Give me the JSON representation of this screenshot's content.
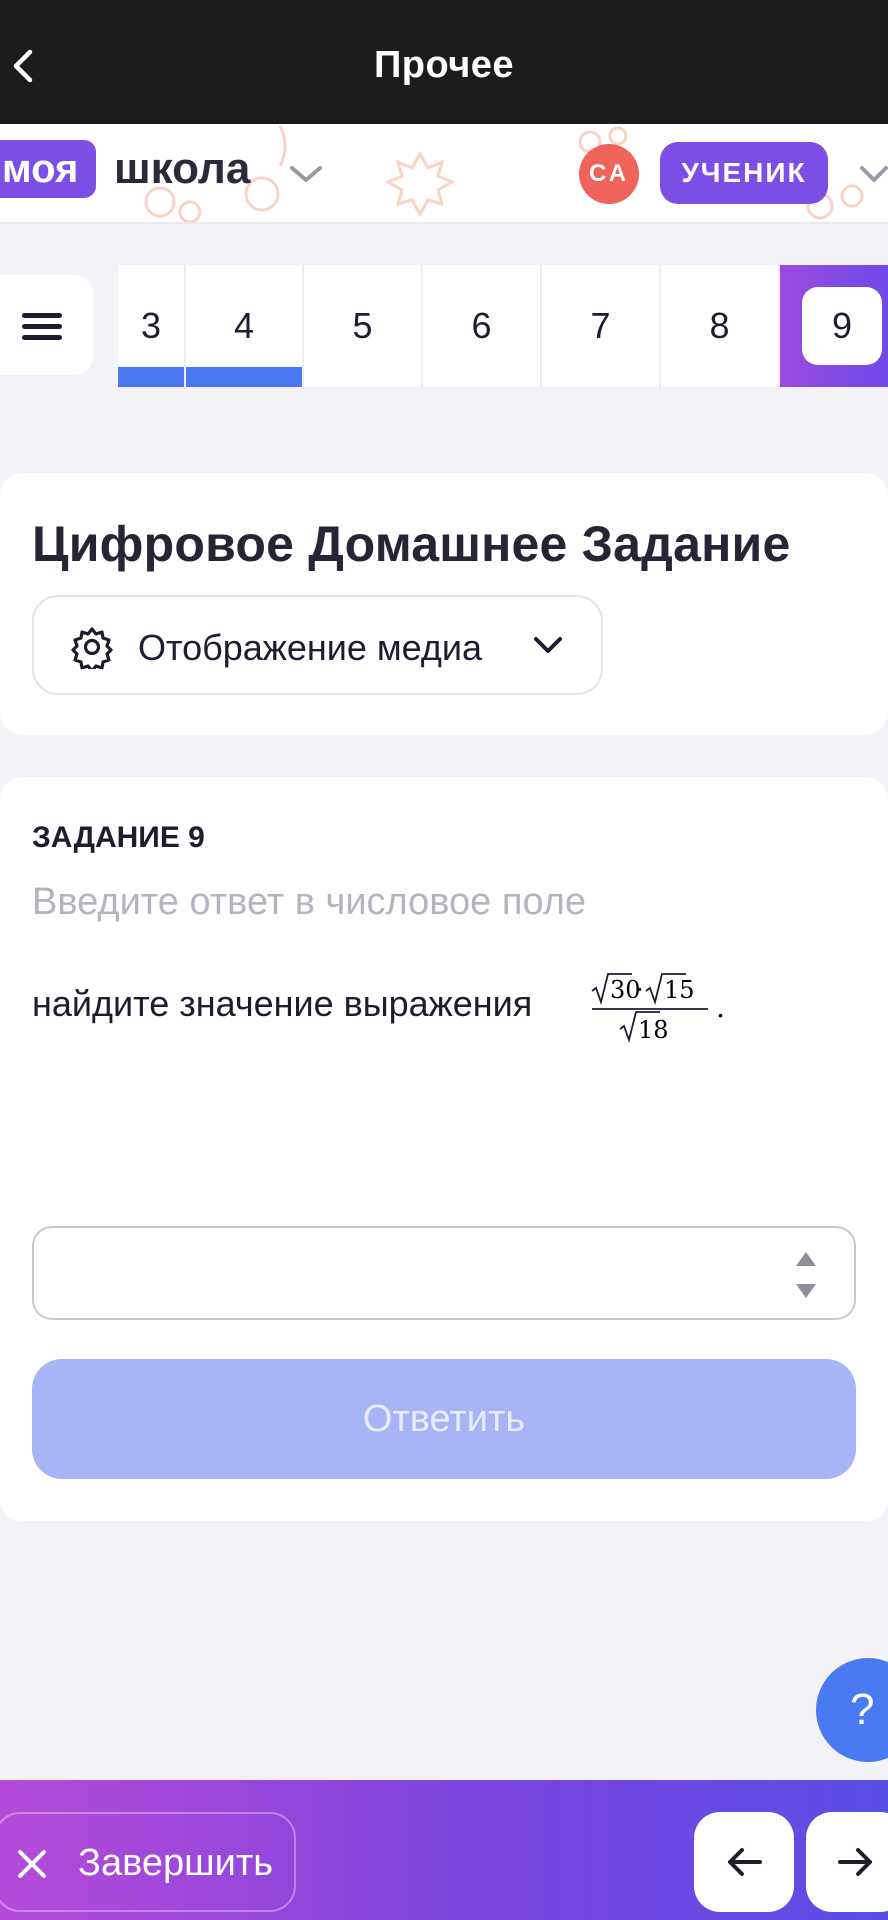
{
  "topbar": {
    "title": "Прочее",
    "back_icon": "chevron-left-icon"
  },
  "app_header": {
    "logo_part1": "моя",
    "logo_part2": "школа",
    "avatar_initials": "СА",
    "role": "УЧЕНИК",
    "colors": {
      "brand_purple": "#7b4ee6",
      "avatar_red": "#f0645c"
    }
  },
  "task_tabs": {
    "menu_icon": "hamburger-icon",
    "items": [
      {
        "label": "3",
        "done": true
      },
      {
        "label": "4",
        "done": true
      },
      {
        "label": "5",
        "done": false
      },
      {
        "label": "6",
        "done": false
      },
      {
        "label": "7",
        "done": false
      },
      {
        "label": "8",
        "done": false
      },
      {
        "label": "9",
        "active": true
      }
    ]
  },
  "header_card": {
    "title": "Цифровое Домашнее Задание",
    "media_button_label": "Отображение медиа"
  },
  "task": {
    "label": "ЗАДАНИЕ 9",
    "hint": "Введите ответ в числовое поле",
    "text": "найдите значение выражения",
    "formula": {
      "numerator_a": "30",
      "numerator_b": "15",
      "denominator": "18",
      "dot": "·",
      "trailing": "."
    },
    "answer_value": "",
    "submit_label": "Ответить"
  },
  "help_label": "?",
  "bottombar": {
    "finish_label": "Завершить",
    "prev_icon": "arrow-left-icon",
    "next_icon": "arrow-right-icon"
  }
}
